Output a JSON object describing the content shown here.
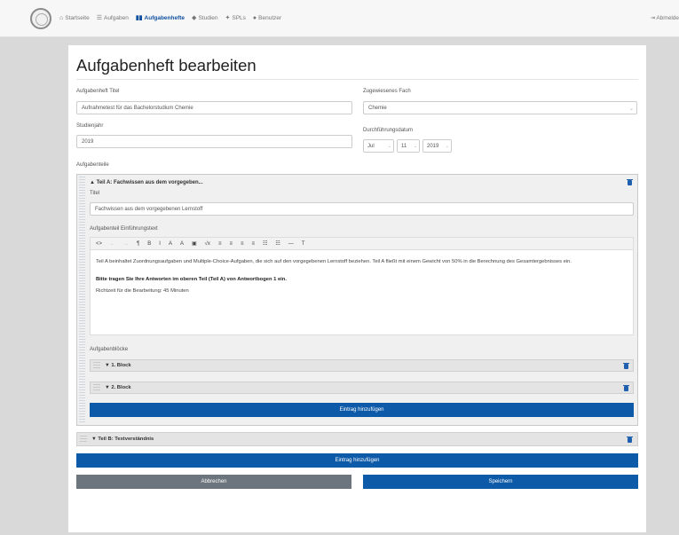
{
  "nav": {
    "items": [
      {
        "icon": "home-icon",
        "glyph": "⌂",
        "label": "Startseite"
      },
      {
        "icon": "list-icon",
        "glyph": "☰",
        "label": "Aufgaben"
      },
      {
        "icon": "book-icon",
        "glyph": "▮▮",
        "label": "Aufgabenhefte"
      },
      {
        "icon": "graduation-cap-icon",
        "glyph": "◆",
        "label": "Studien"
      },
      {
        "icon": "users-icon",
        "glyph": "✦",
        "label": "SPLs"
      },
      {
        "icon": "user-icon",
        "glyph": "●",
        "label": "Benutzer"
      }
    ],
    "logout_glyph": "⇥",
    "logout_label": "Abmelde"
  },
  "page": {
    "title": "Aufgabenheft bearbeiten"
  },
  "form": {
    "titel_label": "Aufgabenheft Titel",
    "titel_value": "Aufnahmetest für das Bachelorstudium Chemie",
    "fach_label": "Zugewiesenes Fach",
    "fach_value": "Chemie",
    "jahr_label": "Studienjahr",
    "jahr_value": "2019",
    "datum_label": "Durchführungsdatum",
    "datum_month": "Jul",
    "datum_day": "11",
    "datum_year": "2019",
    "teile_label": "Aufgabenteile"
  },
  "teil_a": {
    "header": "▲ Teil A: Fachwissen aus dem vorgegeben...",
    "titel_label": "Titel",
    "titel_value": "Fachwissen aus dem vorgegebenen Lernstoff",
    "einf_label": "Aufgabenteil Einführungstext",
    "toolbar": [
      "<>",
      "←",
      "→",
      "¶",
      "B",
      "I",
      "A",
      "A",
      "▣",
      "√x",
      "≡",
      "≡",
      "≡",
      "≡",
      "☷",
      "☷",
      "—",
      "T"
    ],
    "body_p1": "Teil A beinhaltet Zuordnungsaufgaben und Multiple-Choice-Aufgaben, die sich auf den vorgegebenen Lernstoff beziehen. Teil A fließt mit einem Gewicht von 50% in die Berechnung des Gesamtergebnisses ein.",
    "body_strong": "Bitte tragen Sie Ihre Antworten im oberen Teil (Teil A) von Antwortbogen 1 ein.",
    "body_p2": "Richtzeit für die Bearbeitung: 45 Minuten",
    "bloecke_label": "Aufgabenblöcke",
    "block1": "▼ 1. Block",
    "block2": "▼ 2. Block",
    "add_label": "Eintrag hinzufügen"
  },
  "teil_b": {
    "header": "▼ Teil B: Textverständnis"
  },
  "actions": {
    "add_label": "Eintrag hinzufügen",
    "cancel_label": "Abbrechen",
    "save_label": "Speichern"
  },
  "colors": {
    "primary": "#0d5aa8",
    "secondary": "#6c757d",
    "nav_active": "#0f4f9e"
  }
}
